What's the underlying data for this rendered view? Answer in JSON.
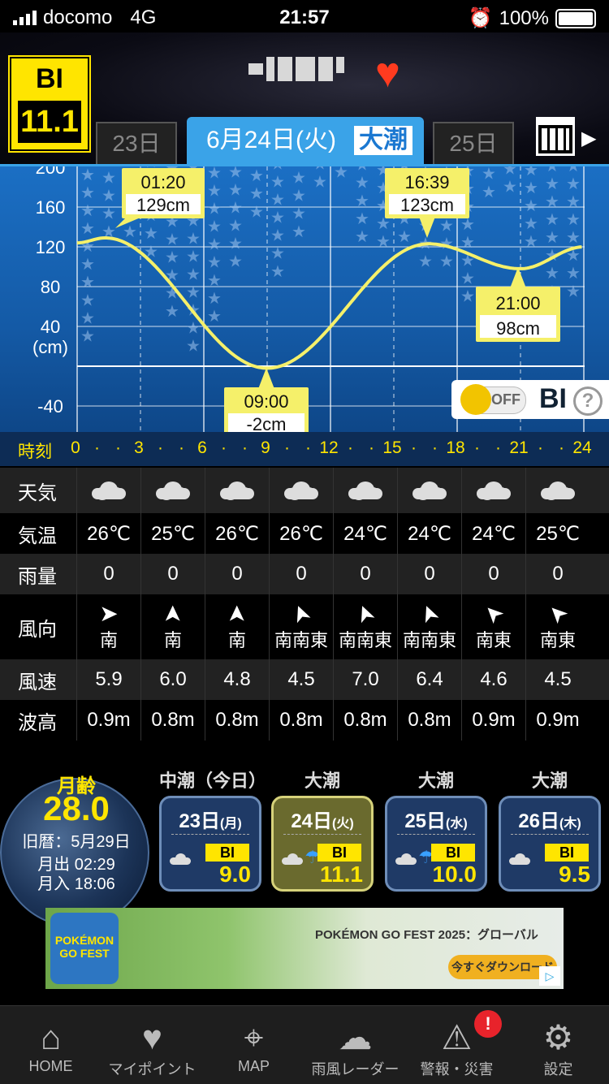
{
  "status": {
    "carrier": "docomo",
    "network": "4G",
    "time": "21:57",
    "battery": "100%"
  },
  "header": {
    "bi_label": "BI",
    "bi_value": "11.1",
    "prev_day": "23日",
    "current_day": "6月24日(火)",
    "current_tide": "大潮",
    "next_day": "25日"
  },
  "tide_chart": {
    "y_labels": [
      "200",
      "160",
      "120",
      "80",
      "40",
      "(cm)",
      "-40"
    ],
    "points": [
      {
        "time": "01:20",
        "height": "129cm"
      },
      {
        "time": "09:00",
        "height": "-2cm"
      },
      {
        "time": "16:39",
        "height": "123cm"
      },
      {
        "time": "21:00",
        "height": "98cm"
      }
    ],
    "toggle_state": "OFF",
    "toggle_label": "BI",
    "help": "?"
  },
  "time_axis": {
    "label": "時刻",
    "ticks": [
      "0",
      "3",
      "6",
      "9",
      "12",
      "15",
      "18",
      "21",
      "24"
    ]
  },
  "forecast": {
    "headers": [
      "天気",
      "気温",
      "雨量",
      "風向",
      "風速",
      "波高"
    ],
    "temps": [
      "26℃",
      "25℃",
      "26℃",
      "26℃",
      "24℃",
      "24℃",
      "24℃",
      "25℃"
    ],
    "rain": [
      "0",
      "0",
      "0",
      "0",
      "0",
      "0",
      "0",
      "0"
    ],
    "wind_dir": [
      "南",
      "南",
      "南",
      "南南東",
      "南南東",
      "南南東",
      "南東",
      "南東"
    ],
    "wind_speed": [
      "5.9",
      "6.0",
      "4.8",
      "4.5",
      "7.0",
      "6.4",
      "4.6",
      "4.5"
    ],
    "wave": [
      "0.9m",
      "0.8m",
      "0.8m",
      "0.8m",
      "0.8m",
      "0.8m",
      "0.9m",
      "0.9m"
    ]
  },
  "moon": {
    "label": "月齢",
    "age": "28.0",
    "lunar": "旧暦：5月29日",
    "rise": "月出 02:29",
    "set": "月入 18:06"
  },
  "days": [
    {
      "tide": "中潮（今日）",
      "date": "23日",
      "dow": "(月)",
      "bi": "BI",
      "value": "9.0"
    },
    {
      "tide": "大潮",
      "date": "24日",
      "dow": "(火)",
      "bi": "BI",
      "value": "11.1"
    },
    {
      "tide": "大潮",
      "date": "25日",
      "dow": "(水)",
      "bi": "BI",
      "value": "10.0"
    },
    {
      "tide": "大潮",
      "date": "26日",
      "dow": "(木)",
      "bi": "BI",
      "value": "9.5"
    }
  ],
  "ad": {
    "title": "POKÉMON GO FEST 2025：グローバル",
    "cta": "今すぐダウンロード",
    "logo": "POKÉMON GO FEST"
  },
  "tabs": [
    "HOME",
    "マイポイント",
    "MAP",
    "雨風レーダー",
    "警報・災害",
    "設定"
  ],
  "alert_count": "!",
  "colors": {
    "accent": "#3aa3e8",
    "bi_yellow": "#ffe500",
    "tide_line": "#f5f06a"
  }
}
